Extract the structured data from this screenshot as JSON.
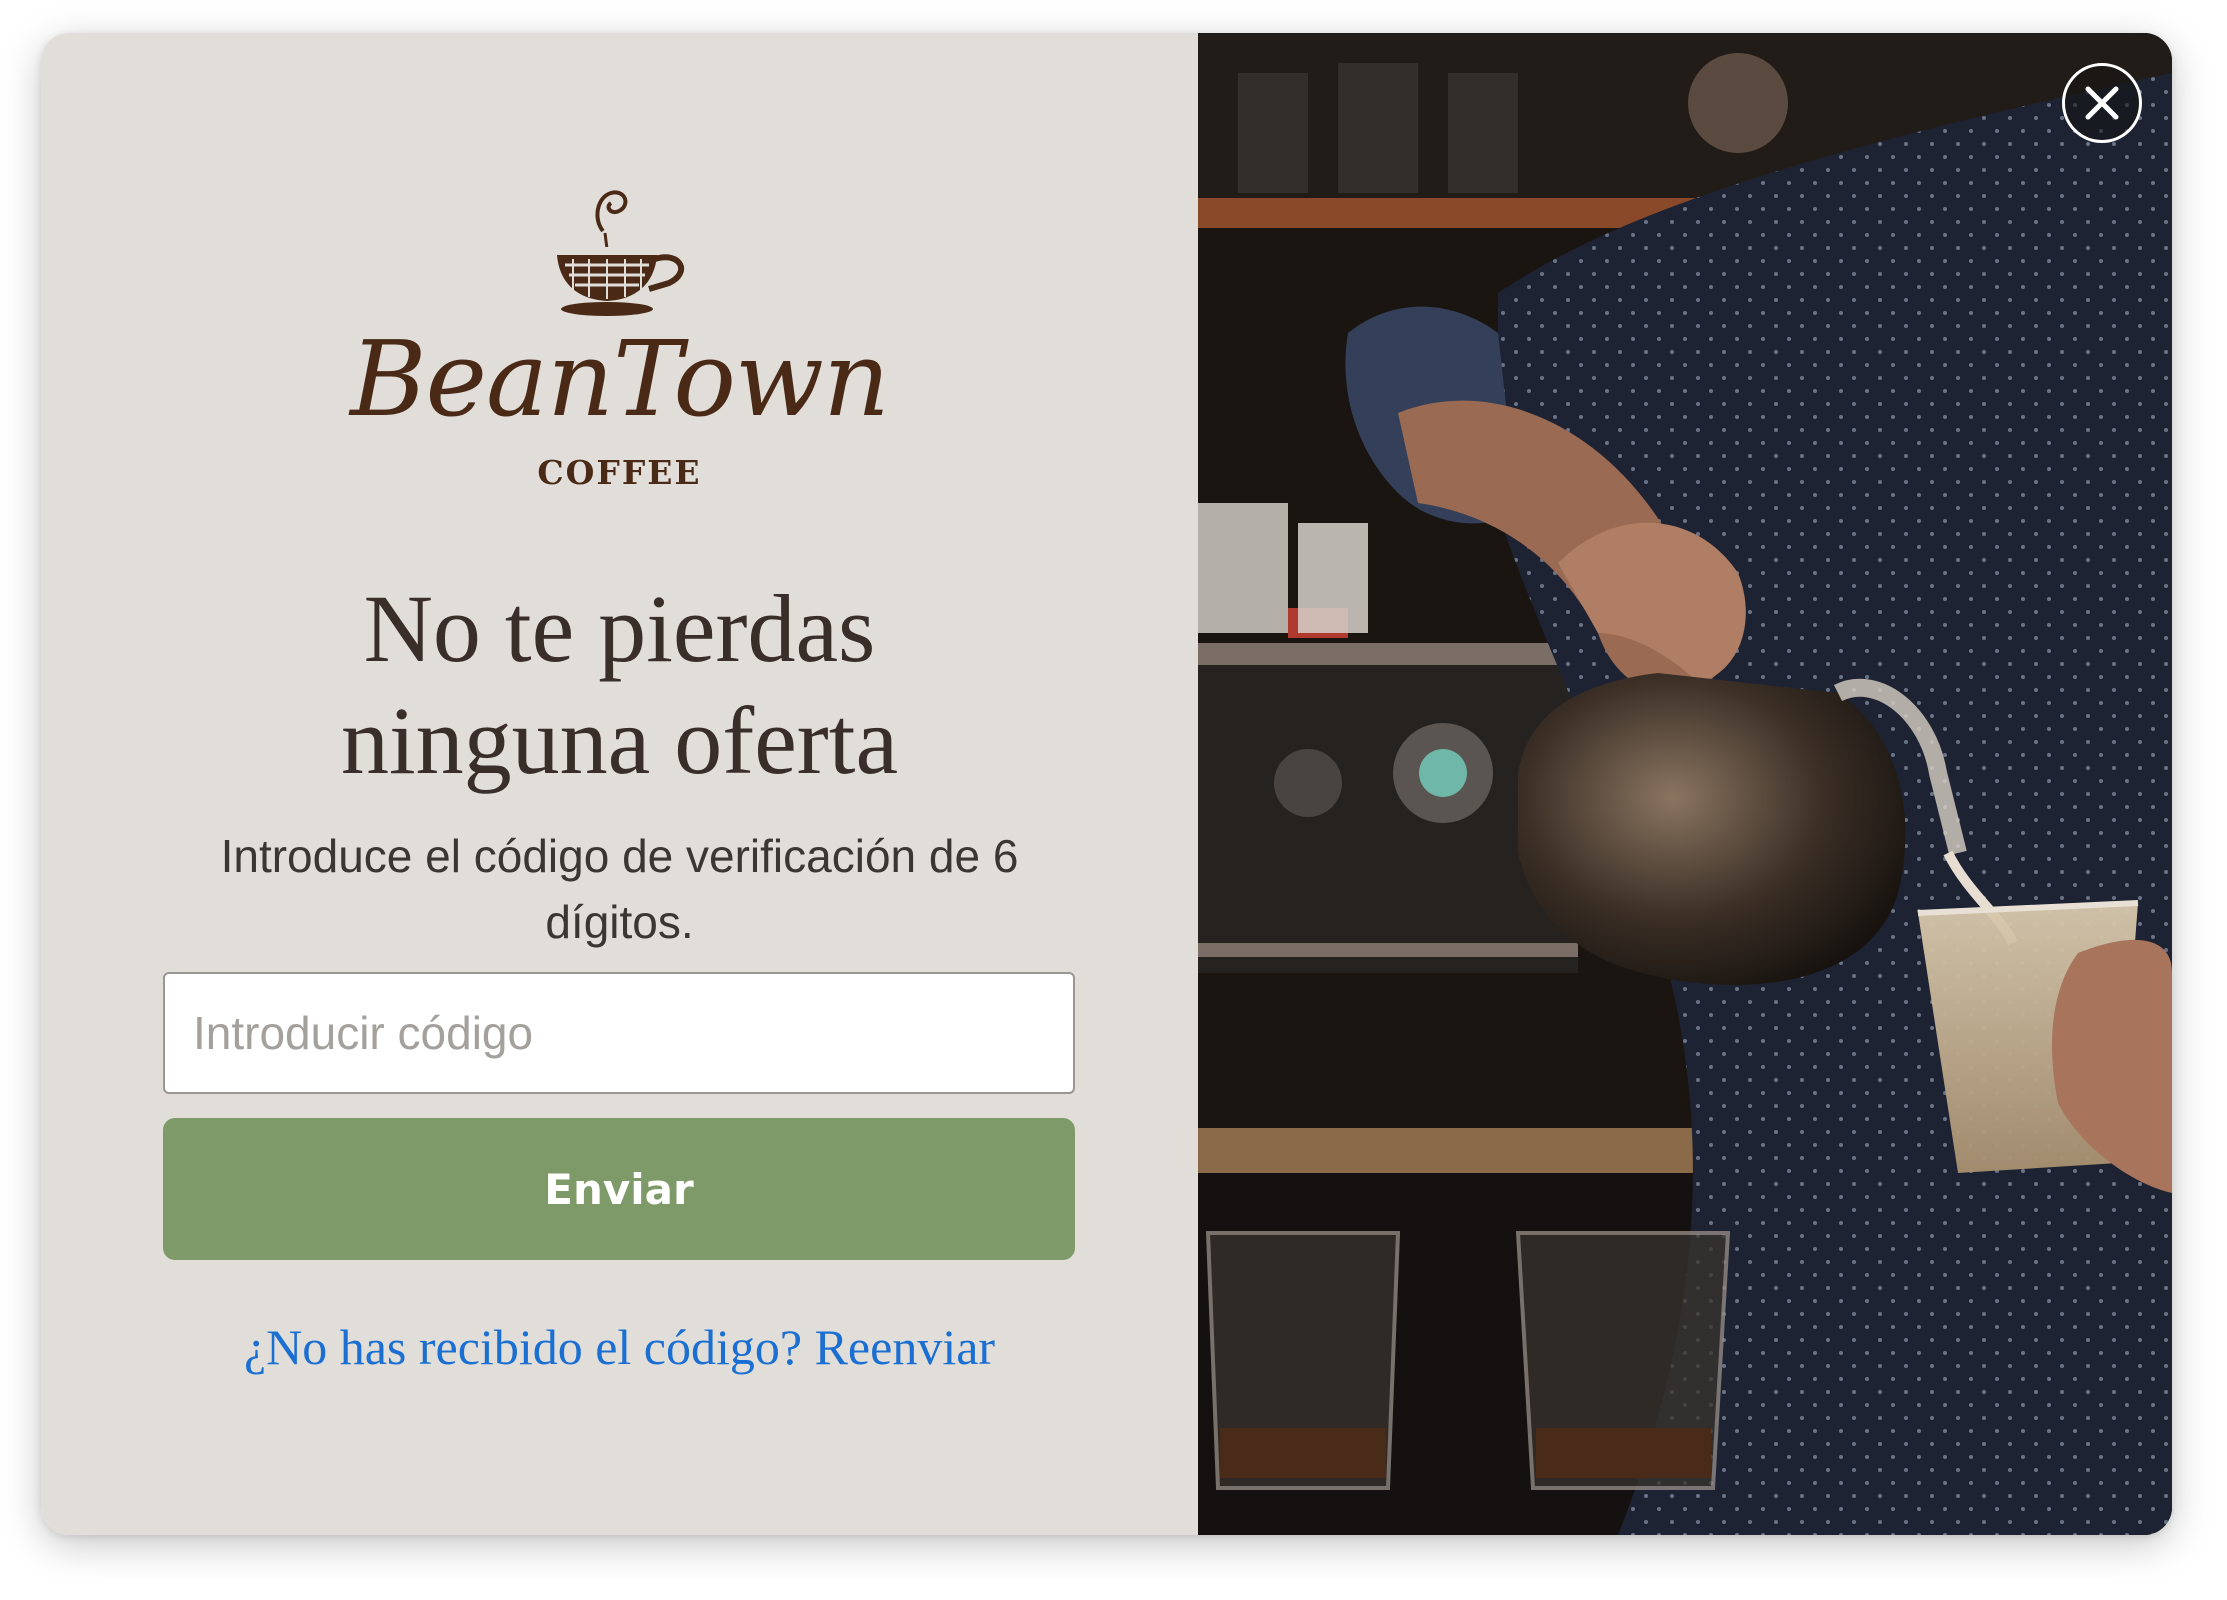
{
  "brand": {
    "name": "BeanTown",
    "tagline": "COFFEE",
    "logo_icon": "coffee-cup-icon"
  },
  "headline": {
    "line1": "No te pierdas",
    "line2": "ninguna oferta"
  },
  "instructions": "Introduce el código de verificación de 6 dígitos.",
  "form": {
    "code_placeholder": "Introducir código",
    "code_value": "",
    "submit_label": "Enviar"
  },
  "resend": {
    "question": "¿No has recibido el código?",
    "action": "Reenviar"
  },
  "close": {
    "icon": "close-icon"
  },
  "colors": {
    "panel_bg": "#e1ded9",
    "brand_brown": "#4a2a17",
    "button_green": "#7e9a68",
    "link_blue": "#1b6ed2"
  }
}
